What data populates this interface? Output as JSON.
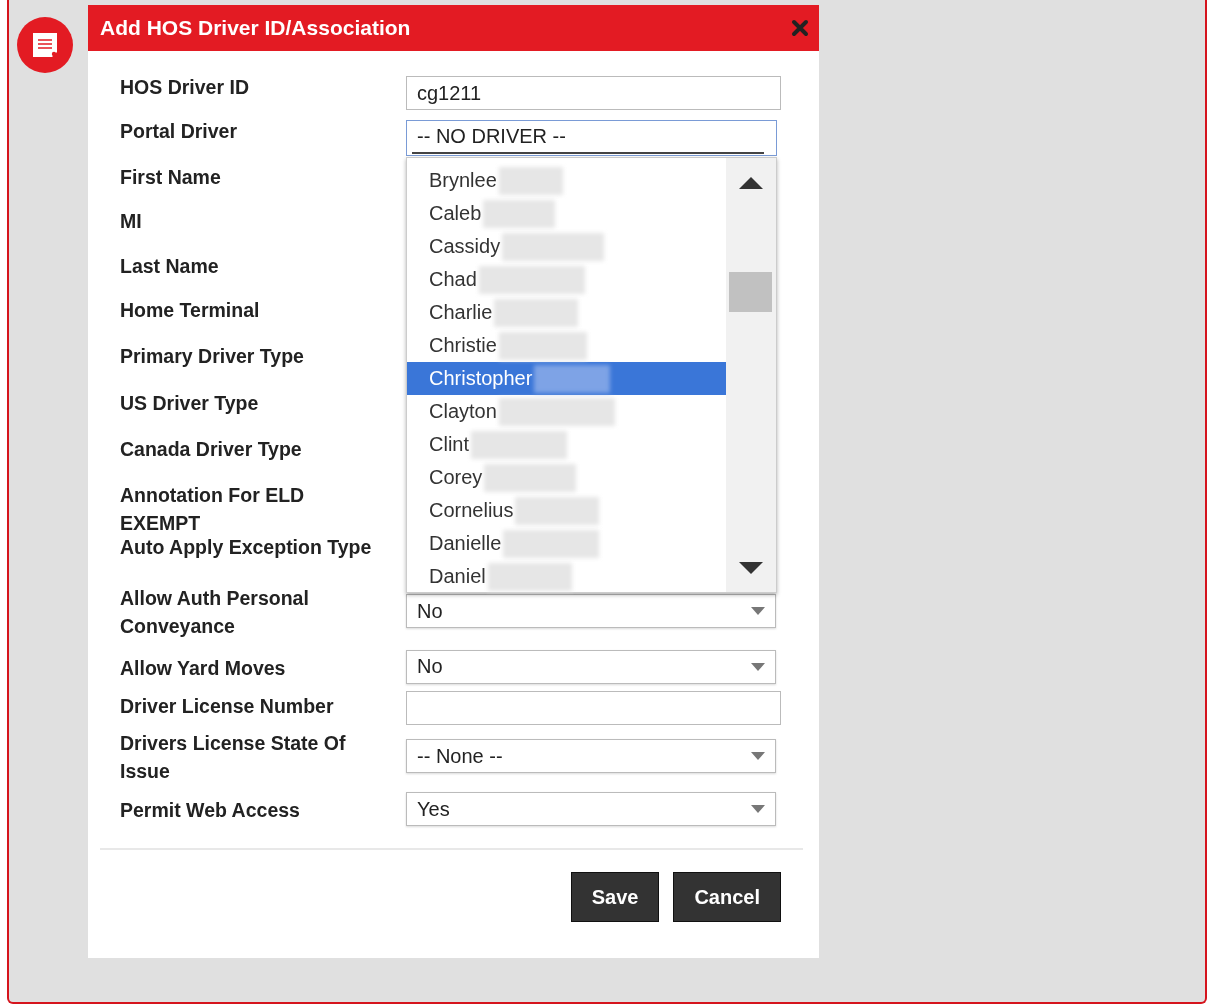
{
  "dialog": {
    "title": "Add HOS Driver ID/Association"
  },
  "fields": [
    {
      "label": "HOS Driver ID",
      "kind": "text",
      "value": "cg1211"
    },
    {
      "label": "Portal Driver",
      "kind": "combo",
      "value": "-- NO DRIVER --"
    },
    {
      "label": "First Name"
    },
    {
      "label": "MI"
    },
    {
      "label": "Last Name"
    },
    {
      "label": "Home Terminal"
    },
    {
      "label": "Primary Driver Type"
    },
    {
      "label": "US Driver Type"
    },
    {
      "label": "Canada Driver Type"
    },
    {
      "label": "Annotation For ELD EXEMPT"
    },
    {
      "label": "Auto Apply Exception Type"
    },
    {
      "label": "Allow Auth Personal Conveyance",
      "kind": "select",
      "value": "No"
    },
    {
      "label": "Allow Yard Moves",
      "kind": "select",
      "value": "No"
    },
    {
      "label": "Driver License Number",
      "kind": "text"
    },
    {
      "label": "Drivers License State Of Issue",
      "kind": "select",
      "value": "-- None --"
    },
    {
      "label": "Permit Web Access",
      "kind": "select",
      "value": "Yes"
    }
  ],
  "dropdown": {
    "options": [
      {
        "name": "Brynlee",
        "selected": false
      },
      {
        "name": "Caleb",
        "selected": false
      },
      {
        "name": "Cassidy",
        "selected": false
      },
      {
        "name": "Chad",
        "selected": false
      },
      {
        "name": "Charlie",
        "selected": false
      },
      {
        "name": "Christie",
        "selected": false
      },
      {
        "name": "Christopher",
        "selected": true
      },
      {
        "name": "Clayton",
        "selected": false
      },
      {
        "name": "Clint",
        "selected": false
      },
      {
        "name": "Corey",
        "selected": false
      },
      {
        "name": "Cornelius",
        "selected": false
      },
      {
        "name": "Danielle",
        "selected": false
      },
      {
        "name": "Daniel",
        "selected": false
      }
    ]
  },
  "buttons": [
    "Save",
    "Cancel"
  ]
}
